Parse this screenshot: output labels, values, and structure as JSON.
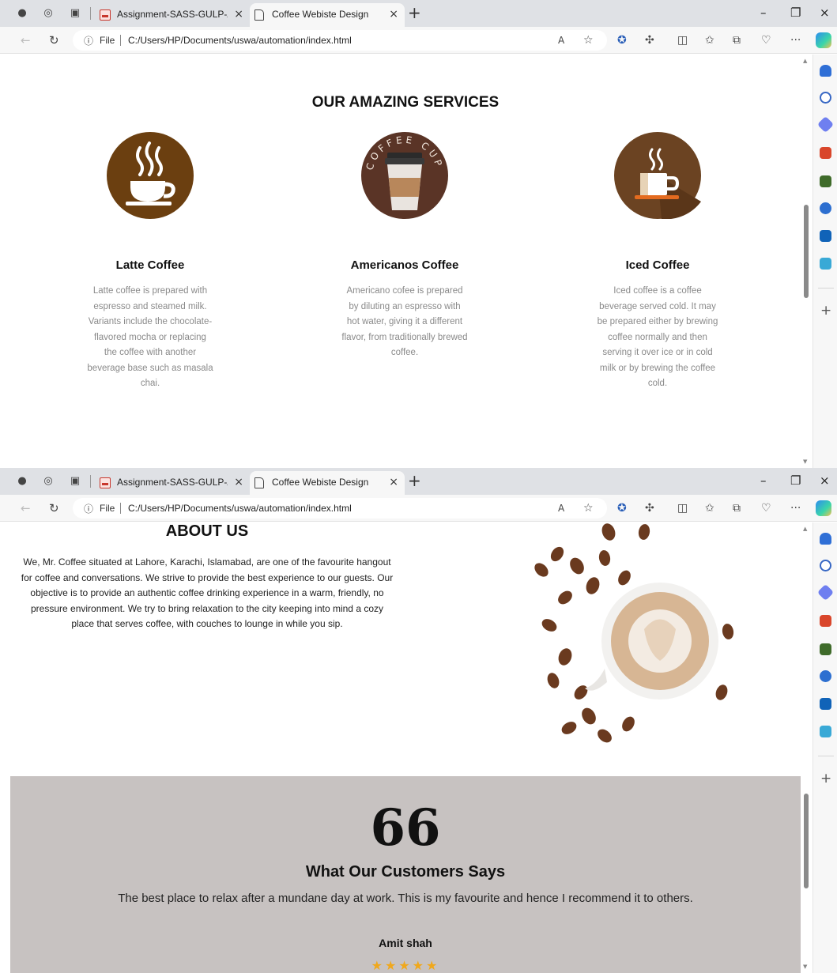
{
  "browser": {
    "tabs": [
      {
        "title": "Assignment-SASS-GULP-AUTOM",
        "close": "×"
      },
      {
        "title": "Coffee Webiste Design",
        "close": "×"
      }
    ],
    "new_tab": "+",
    "window_controls": {
      "minimize": "–",
      "restore": "❐",
      "close": "×"
    },
    "address": {
      "info": "ⓘ",
      "scheme_label": "File",
      "url": "C:/Users/HP/Documents/uswa/automation/index.html"
    },
    "toolbar": {
      "read_aloud": "A",
      "more": "···"
    },
    "sidebar_add": "+"
  },
  "services": {
    "title": "OUR AMAZING SERVICES",
    "cup_logo_text": "COFFEE CUP",
    "items": [
      {
        "name": "Latte Coffee",
        "description": "Latte coffee is prepared with espresso and steamed milk. Variants include the chocolate-flavored mocha or replacing the coffee with another beverage base such as masala chai."
      },
      {
        "name": "Americanos Coffee",
        "description": "Americano cofee is prepared by diluting an espresso with hot water, giving it a different flavor, from traditionally brewed coffee."
      },
      {
        "name": "Iced Coffee",
        "description": "Iced coffee is a coffee beverage served cold. It may be prepared either by brewing coffee normally and then serving it over ice or in cold milk or by brewing the coffee cold."
      }
    ]
  },
  "about": {
    "title": "ABOUT US",
    "text": "We, Mr. Coffee situated at Lahore, Karachi, Islamabad, are one of the favourite hangout for coffee and conversations. We strive to provide the best experience to our guests. Our objective is to provide an authentic coffee drinking experience in a warm, friendly, no pressure environment. We try to bring relaxation to the city keeping into mind a cozy place that serves coffee, with couches to lounge in while you sip."
  },
  "testimonial": {
    "quote_mark": "66",
    "title": "What Our Customers Says",
    "text": "The best place to relax after a mundane day at work. This is my favourite and hence I recommend it to others.",
    "name": "Amit shah",
    "rating": 5,
    "rating_max": 5
  },
  "colors": {
    "tab_strip": "#dfe1e5",
    "toolbar": "#f7f7f7",
    "latte_circle": "#6b3f10",
    "americano_circle": "#5a3426",
    "iced_circle": "#6b4322",
    "testimonial_bg": "#c7c2c1",
    "star": "#f0a81c"
  },
  "icons": [
    "profile-icon",
    "workspaces-icon",
    "tab-actions-icon",
    "back-icon",
    "refresh-icon",
    "read-aloud-icon",
    "favorite-star-icon",
    "extension-icon",
    "copilot-icon"
  ]
}
